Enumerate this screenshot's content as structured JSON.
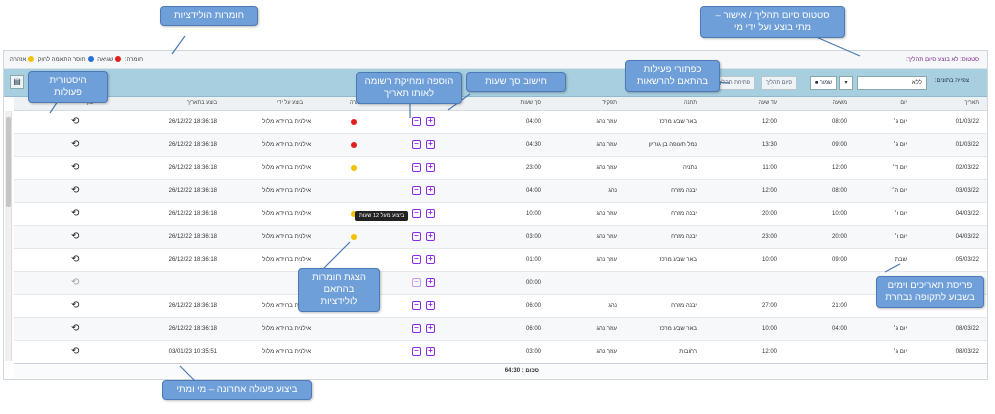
{
  "status_bar": {
    "status_text": "סטטוס: לא בוצע סיום תהליך:",
    "legend_label": "חומרה:",
    "legend_items": [
      "שגיאה",
      "חוסר התאמה לחוק",
      "אזהרה"
    ]
  },
  "toolbar": {
    "tb_label": "צפייה בתונים:",
    "select_value": "ללא",
    "save": "שמור",
    "finish": "סיום תהליך",
    "open": "פתיחת תהליך"
  },
  "headers": {
    "date": "תאריך",
    "day": "יום",
    "from": "משעה",
    "to": "עד שעה",
    "station": "תחנה",
    "role": "תפקיד",
    "hours": "סך שעות",
    "action": "פעולה",
    "severity": "חומרה",
    "by": "בוצע על ידי",
    "at": "בוצע בתאריך",
    "log": "יומן"
  },
  "rows": [
    {
      "date": "01/03/22",
      "day": "יום ג׳",
      "from": "08:00",
      "to": "12:00",
      "station": "באר שבע מרכז",
      "role": "עוזר נהג",
      "hours": "04:00",
      "sev": "#e02020",
      "by": "אילנית ברוידא מלול",
      "at": "18:36:18 26/12/22",
      "dim": false
    },
    {
      "date": "01/03/22",
      "day": "יום ג׳",
      "from": "09:00",
      "to": "13:30",
      "station": "נמל תעופה בן גוריון",
      "role": "עוזר נהג",
      "hours": "04:30",
      "sev": "#e02020",
      "by": "אילנית ברוידא מלול",
      "at": "18:36:18 26/12/22",
      "dim": false
    },
    {
      "date": "02/03/22",
      "day": "יום ד׳",
      "from": "12:00",
      "to": "11:00",
      "station": "נתניה",
      "role": "עוזר נהג",
      "hours": "23:00",
      "sev": "#f2c200",
      "by": "אילנית ברוידא מלול",
      "at": "18:36:18 26/12/22",
      "dim": false
    },
    {
      "date": "03/03/22",
      "day": "יום ה׳",
      "from": "08:00",
      "to": "12:00",
      "station": "יבנה מזרח",
      "role": "נהג",
      "hours": "04:00",
      "sev": "",
      "by": "אילנית ברוידא מלול",
      "at": "18:36:18 26/12/22",
      "dim": false
    },
    {
      "date": "04/03/22",
      "day": "יום ו׳",
      "from": "10:00",
      "to": "20:00",
      "station": "יבנה מזרח",
      "role": "עוזר נהג",
      "hours": "10:00",
      "sev": "#f2c200",
      "by": "אילנית ברוידא מלול",
      "at": "18:36:18 26/12/22",
      "dim": false
    },
    {
      "date": "04/03/22",
      "day": "יום ו׳",
      "from": "20:00",
      "to": "23:00",
      "station": "יבנה מזרח",
      "role": "עוזר נהג",
      "hours": "03:00",
      "sev": "#f2c200",
      "by": "אילנית ברוידא מלול",
      "at": "18:36:18 26/12/22",
      "dim": false
    },
    {
      "date": "05/03/22",
      "day": "שבת",
      "from": "09:00",
      "to": "10:00",
      "station": "באר שבע מרכז",
      "role": "עוזר נהג",
      "hours": "01:00",
      "sev": "",
      "by": "אילנית ברוידא מלול",
      "at": "18:36:18 26/12/22",
      "dim": false
    },
    {
      "date": "06/03/22",
      "day": "יום א׳",
      "from": "",
      "to": "",
      "station": "",
      "role": "",
      "hours": "00:00",
      "sev": "",
      "by": "",
      "at": "",
      "dim": true
    },
    {
      "date": "07/03/22",
      "day": "יום ב׳",
      "from": "21:00",
      "to": "27:00",
      "station": "יבנה מזרח",
      "role": "נהג",
      "hours": "06:00",
      "sev": "",
      "by": "אילנית ברוידא מלול",
      "at": "18:36:18 26/12/22",
      "dim": false
    },
    {
      "date": "08/03/22",
      "day": "יום ג׳",
      "from": "04:00",
      "to": "10:00",
      "station": "באר שבע מרכז",
      "role": "עוזר נהג",
      "hours": "06:00",
      "sev": "",
      "by": "אילנית ברוידא מלול",
      "at": "18:36:18 26/12/22",
      "dim": false
    },
    {
      "date": "08/03/22",
      "day": "יום ג׳",
      "from": "",
      "to": "12:00",
      "station": "רחובות",
      "role": "עוזר נהג",
      "hours": "03:00",
      "sev": "",
      "by": "אילנית ברוידא מלול",
      "at": "10:35:51 03/01/23",
      "dim": false
    }
  ],
  "footer": {
    "total": "סכום : 64:30"
  },
  "tooltip": "ביצוע מעל 12 שעות",
  "callouts": {
    "severities": "חומרות הולידציות",
    "status": "סטטוס סיום תהליך / אישור – מתי בוצע ועל ידי מי",
    "buttons": "כפתורי פעילות בהתאם להרשאות",
    "history": "היסטורית פעולות",
    "addremove": "הוספה ומחיקת רשומה לאותו תאריך",
    "hours": "חישוב סך שעות",
    "severity_display": "הצגת חומרות בהתאם לולידציות",
    "dates": "פריסת תאריכים וימים בשבוע לתקופה נבחרת",
    "last": "ביצוע פעולה אחרונה – מי ומתי"
  }
}
